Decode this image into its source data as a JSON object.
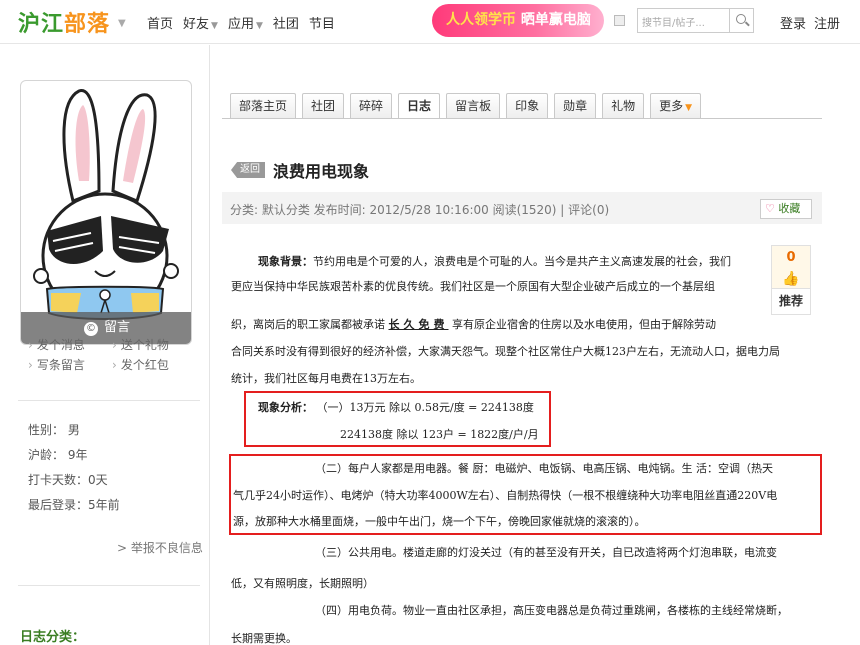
{
  "header": {
    "logo_a": "沪江",
    "logo_b": "部落",
    "nav": [
      {
        "label": "首页",
        "caret": false
      },
      {
        "label": "好友",
        "caret": true
      },
      {
        "label": "应用",
        "caret": true
      },
      {
        "label": "社团",
        "caret": false
      },
      {
        "label": "节目",
        "caret": false
      }
    ],
    "banner_a": "人人领学币",
    "banner_b": "晒单赢电脑",
    "search_placeholder": "搜节目/帖子...",
    "login": "登录",
    "register": "注册"
  },
  "profile": {
    "leave_message": "留言",
    "actions": [
      [
        "发个消息",
        "送个礼物"
      ],
      [
        "写条留言",
        "发个红包"
      ]
    ],
    "info": [
      "性别： 男",
      "沪龄： 9年",
      "打卡天数：0天",
      "最后登录：5年前"
    ],
    "report": "> 举报不良信息",
    "category_title": "日志分类："
  },
  "tabs": [
    {
      "label": "部落主页",
      "active": false,
      "more": false
    },
    {
      "label": "社团",
      "active": false,
      "more": false
    },
    {
      "label": "碎碎",
      "active": false,
      "more": false
    },
    {
      "label": "日志",
      "active": true,
      "more": false
    },
    {
      "label": "留言板",
      "active": false,
      "more": false
    },
    {
      "label": "印象",
      "active": false,
      "more": false
    },
    {
      "label": "勋章",
      "active": false,
      "more": false
    },
    {
      "label": "礼物",
      "active": false,
      "more": false
    },
    {
      "label": "更多",
      "active": false,
      "more": true
    }
  ],
  "post": {
    "back_label": "返回",
    "title": "浪费用电现象",
    "meta": "分类: 默认分类    发布时间: 2012/5/28 10:16:00    阅读(1520)  |  评论(0)",
    "favorite": "收藏",
    "recommend_count": "0",
    "recommend_label": "推荐",
    "p1_bold": "现象背景：",
    "p1_l1": "节约用电是个可爱的人，浪费电是个可耻的人。当今是共产主义高速发展的社会，我们",
    "p1_l2": "更应当保持中华民族艰苦朴素的优良传统。我们社区是一个原国有大型企业破产后成立的一个基层组",
    "p1_l3a": "织，离岗后的职工家属都被承诺",
    "p1_l3u": "长久免费",
    "p1_l3b": "享有原企业宿舍的住房以及水电使用，但由于解除劳动",
    "p1_l4": "合同关系时没有得到很好的经济补偿，大家满天怨气。现整个社区常住户大概123户左右，无流动人口，据电力局",
    "p1_l5": "统计，我们社区每月电费在13万左右。",
    "a_bold": "现象分析：",
    "a_l1": "（一）13万元 除以 0.58元/度 = 224138度",
    "a_l2": "224138度 除以 123户 = 1822度/户/月",
    "b_l1": "（二）每户人家都是用电器。餐 厨：电磁炉、电饭锅、电高压锅、电炖锅。生 活：空调（热天",
    "b_l2": "气几乎24小时运作）、电烤炉（特大功率4000W左右）、自制热得快（一根不根缠绕种大功率电阻丝直通220V电",
    "b_l3": "源，放那种大水桶里面烧，一般中午出门，烧一个下午，傍晚回家催就烧的滚滚的）。",
    "c_l1": "（三）公共用电。楼道走廊的灯没关过（有的甚至没有开关，自已改造将两个灯泡串联，电流变",
    "c_l2": "低，又有照明度，长期照明）",
    "d_l1": "（四）用电负荷。物业一直由社区承担，高压变电器总是负荷过重跳闸，各楼栋的主线经常烧断，",
    "d_l2": "长期需更换。"
  }
}
